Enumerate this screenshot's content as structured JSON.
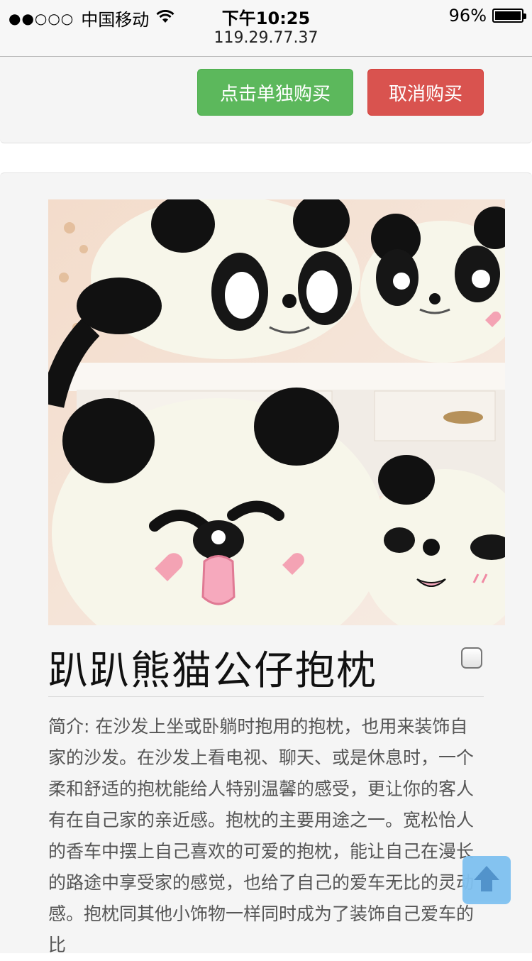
{
  "status_bar": {
    "signal": "●●○○○",
    "carrier": "中国移动",
    "time": "下午10:25",
    "url": "119.29.77.37",
    "battery_percent": "96%",
    "battery_level": 0.96
  },
  "actions": {
    "buy_single_label": "点击单独购买",
    "cancel_label": "取消购买"
  },
  "product": {
    "title": "趴趴熊猫公仔抱枕",
    "description": "简介: 在沙发上坐或卧躺时抱用的抱枕，也用来装饰自家的沙发。在沙发上看电视、聊天、或是休息时，一个柔和舒适的抱枕能给人特别温馨的感受，更让你的客人有在自己家的亲近感。抱枕的主要用途之一。宽松怡人的香车中摆上自己喜欢的可爱的抱枕，能让自己在漫长的路途中享受家的感觉，也给了自己的爱车无比的灵动感。抱枕同其他小饰物一样同时成为了装饰自己爱车的比"
  },
  "colors": {
    "green": "#5cb85c",
    "red": "#d9534f",
    "back_to_top": "#7fc1f0"
  },
  "icons": {
    "wifi": "wifi-icon",
    "battery": "battery-icon",
    "back_to_top": "arrow-up-icon",
    "checkbox": "checkbox-unchecked"
  }
}
